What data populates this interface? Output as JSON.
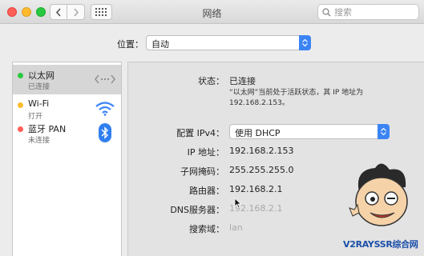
{
  "window": {
    "title": "网络"
  },
  "search": {
    "placeholder": "搜索"
  },
  "location": {
    "label": "位置：",
    "value": "自动"
  },
  "services": [
    {
      "name": "以太网",
      "status": "已连接",
      "dot_color": "#28c840",
      "icon": "ethernet-arrows-icon"
    },
    {
      "name": "Wi-Fi",
      "status": "打开",
      "dot_color": "#febb2e",
      "icon": "wifi-icon"
    },
    {
      "name": "蓝牙 PAN",
      "status": "未连接",
      "dot_color": "#fe5f57",
      "icon": "bluetooth-icon"
    }
  ],
  "detail": {
    "status_label": "状态：",
    "status_value": "已连接",
    "status_desc_line1": "“以太网”当前处于活跃状态，其 IP 地址为",
    "status_desc_line2": "192.168.2.153。",
    "configure_label": "配置 IPv4：",
    "configure_value": "使用 DHCP",
    "ip_label": "IP 地址：",
    "ip_value": "192.168.2.153",
    "subnet_label": "子网掩码：",
    "subnet_value": "255.255.255.0",
    "router_label": "路由器：",
    "router_value": "192.168.2.1",
    "dns_label": "DNS服务器：",
    "dns_value": "192.168.2.1",
    "search_domain_label": "搜索域：",
    "search_domain_value": "lan"
  },
  "watermark": {
    "text": "V2RAYSSR综合网"
  },
  "colors": {
    "accent": "#3b84f5",
    "selected_row": "#d6d6d6"
  }
}
